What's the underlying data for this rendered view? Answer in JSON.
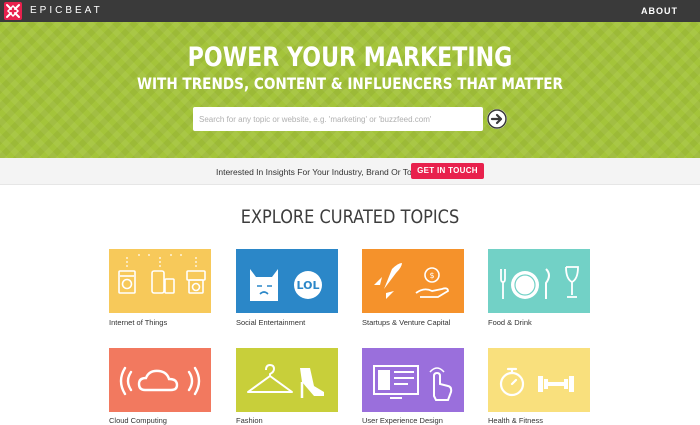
{
  "nav": {
    "brand": "EPICBEAT",
    "about": "ABOUT"
  },
  "hero": {
    "title": "POWER YOUR MARKETING",
    "subtitle": "WITH TRENDS, CONTENT & INFLUENCERS THAT MATTER",
    "search_placeholder": "Search for any topic or website, e.g. 'marketing' or 'buzzfeed.com'"
  },
  "cta": {
    "text": "Interested In Insights For Your Industry, Brand Or Topic?",
    "button": "GET IN TOUCH"
  },
  "section_title": "EXPLORE CURATED TOPICS",
  "topics": [
    {
      "label": "Internet of Things",
      "color": "#f7c95a",
      "icon": "appliances-icon"
    },
    {
      "label": "Social Entertainment",
      "color": "#2b87c8",
      "icon": "cat-lol-icon"
    },
    {
      "label": "Startups & Venture Capital",
      "color": "#f5922b",
      "icon": "rocket-money-icon"
    },
    {
      "label": "Food & Drink",
      "color": "#72d1c6",
      "icon": "plate-cutlery-icon"
    },
    {
      "label": "Cloud Computing",
      "color": "#f2795f",
      "icon": "cloud-icon"
    },
    {
      "label": "Fashion",
      "color": "#c8cf3a",
      "icon": "hanger-heel-icon"
    },
    {
      "label": "User Experience Design",
      "color": "#9a6fdc",
      "icon": "screen-touch-icon"
    },
    {
      "label": "Health & Fitness",
      "color": "#f9e07d",
      "icon": "stopwatch-dumbbell-icon"
    }
  ]
}
